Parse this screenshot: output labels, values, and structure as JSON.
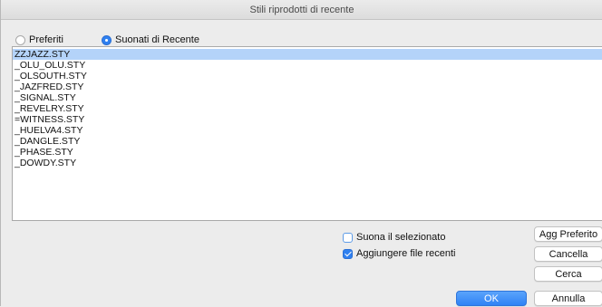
{
  "window": {
    "title": "Stili riprodotti di recente"
  },
  "radio_options": [
    {
      "label": "Preferiti",
      "checked": false
    },
    {
      "label": "Suonati di Recente",
      "checked": true
    }
  ],
  "list": {
    "selected_index": 0,
    "items": [
      "ZZJAZZ.STY",
      "_OLU_OLU.STY",
      "_OLSOUTH.STY",
      "_JAZFRED.STY",
      "_SIGNAL.STY",
      "_REVELRY.STY",
      "=WITNESS.STY",
      "_HUELVA4.STY",
      "_DANGLE.STY",
      "_PHASE.STY",
      "_DOWDY.STY"
    ]
  },
  "options": {
    "play_selected": {
      "label": "Suona il selezionato",
      "checked": false
    },
    "add_recent_files": {
      "label": "Aggiungere file recenti",
      "checked": true
    }
  },
  "buttons": {
    "add_favorite": "Agg Preferito",
    "delete": "Cancella",
    "search": "Cerca",
    "ok": "OK",
    "cancel": "Annulla"
  },
  "colors": {
    "accent": "#2f80f0",
    "selection": "#b4d3f9"
  }
}
